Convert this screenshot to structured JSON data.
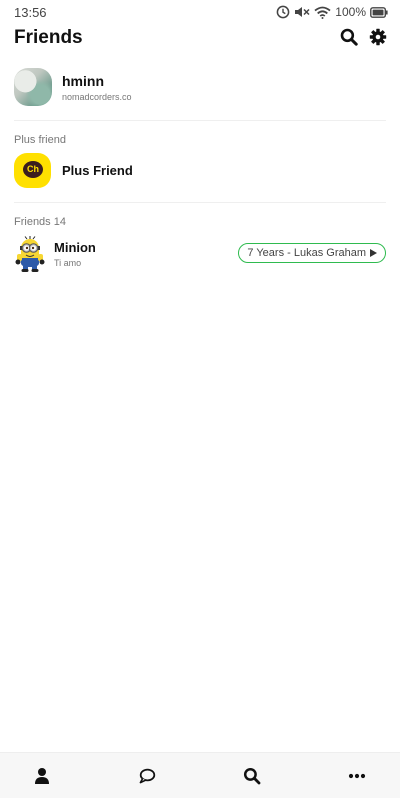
{
  "status_bar": {
    "time": "13:56",
    "battery": "100%",
    "icons": [
      "alarm-icon",
      "mute-icon",
      "wifi-icon",
      "battery-icon"
    ]
  },
  "header": {
    "title": "Friends",
    "icons": [
      "search-icon",
      "settings-icon"
    ]
  },
  "profile": {
    "name": "hminn",
    "status": "nomadcorders.co"
  },
  "plus_friend_section": {
    "label": "Plus friend",
    "item": {
      "name": "Plus Friend",
      "badge": "Ch"
    }
  },
  "friends_section": {
    "label": "Friends 14",
    "items": [
      {
        "name": "Minion",
        "status": "Ti amo",
        "music": "7 Years - Lukas Graham"
      }
    ]
  },
  "bottom_nav": {
    "items": [
      "person-icon",
      "chat-icon",
      "search-icon",
      "more-icon"
    ]
  },
  "colors": {
    "accent_green": "#2fbb4f",
    "plus_yellow": "#ffe000",
    "text": "#111111"
  }
}
